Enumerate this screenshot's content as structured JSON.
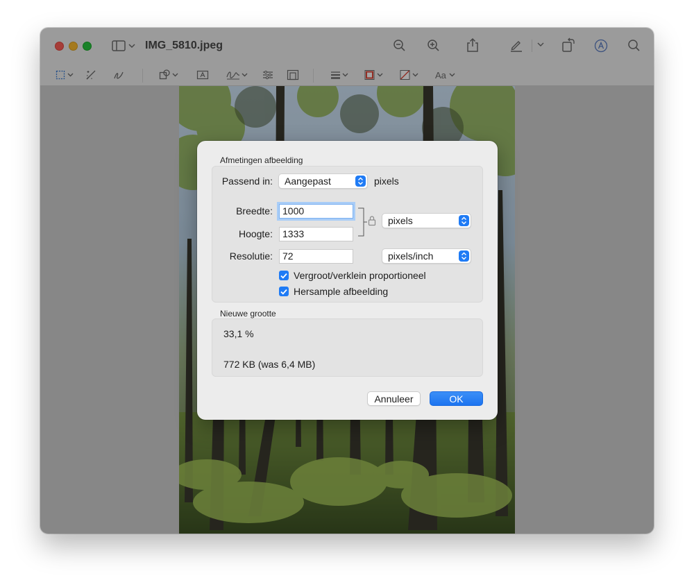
{
  "window": {
    "title": "IMG_5810.jpeg"
  },
  "toolbar": {
    "top_icons": [
      "sidebar-icon",
      "zoom-out-icon",
      "zoom-in-icon",
      "share-icon",
      "markup-pen-icon",
      "rotate-icon",
      "annotate-icon",
      "search-icon"
    ],
    "markup_icons": [
      "rect-select-icon",
      "instant-alpha-icon",
      "sketch-icon",
      "shapes-icon",
      "text-box-icon",
      "sign-icon",
      "adjust-color-icon",
      "adjust-size-icon",
      "line-style-icon",
      "border-color-icon",
      "fill-color-icon",
      "font-icon"
    ],
    "font_label": "Aa"
  },
  "dialog": {
    "section_dimensions": "Afmetingen afbeelding",
    "fit_label": "Passend in:",
    "fit_value": "Aangepast",
    "fit_unit": "pixels",
    "width_label": "Breedte:",
    "width_value": "1000",
    "height_label": "Hoogte:",
    "height_value": "1333",
    "size_unit": "pixels",
    "resolution_label": "Resolutie:",
    "resolution_value": "72",
    "resolution_unit": "pixels/inch",
    "scale_proportional": "Vergroot/verklein proportioneel",
    "resample": "Hersample afbeelding",
    "section_new_size": "Nieuwe grootte",
    "new_size_percent": "33,1 %",
    "new_size_bytes": "772 KB (was 6,4 MB)",
    "cancel_label": "Annuleer",
    "ok_label": "OK"
  },
  "colors": {
    "accent": "#1f7bf5",
    "close": "#ff5f57",
    "minimize": "#febc2e",
    "maximize": "#28c840"
  }
}
